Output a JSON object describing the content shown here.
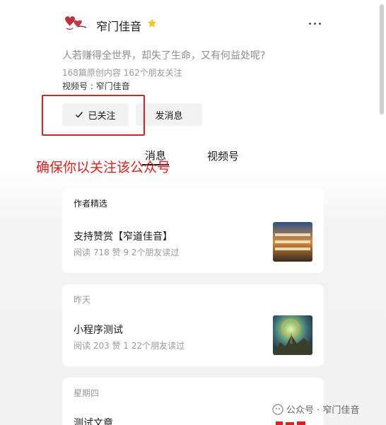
{
  "account": {
    "name": "窄门佳音",
    "bio": "人若赚得全世界，却失了生命，又有何益处呢?",
    "stats": "168篇原创内容  162个朋友关注",
    "channel": "视频号 : 窄门佳音"
  },
  "buttons": {
    "follow": "已关注",
    "message": "发消息"
  },
  "tabs": [
    "消息",
    "视频号"
  ],
  "annotation": "确保你以关注该公众号",
  "cards": [
    {
      "section": "作者精选",
      "title": "支持赞赏【窄道佳音】",
      "meta": "阅读 718  赞 9  2个朋友读过"
    },
    {
      "section": "昨天",
      "title": "小程序测试",
      "meta": "阅读 203  赞 1  22个朋友读过"
    },
    {
      "section": "星期四",
      "title": "测试文章"
    }
  ],
  "watermark": "公众号 · 窄门佳音",
  "colors": {
    "accent_red": "#e02020",
    "star": "#f5c518",
    "background": "#f2f2f2"
  }
}
